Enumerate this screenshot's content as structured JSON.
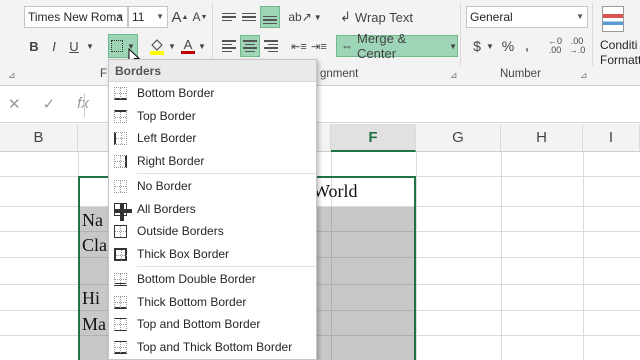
{
  "ribbon": {
    "font_name": "Times New Roma",
    "font_size": "11",
    "grow_font": "A",
    "shrink_font": "A",
    "bold": "B",
    "italic": "I",
    "underline": "U",
    "wrap_text": "Wrap Text",
    "merge_center": "Merge & Center",
    "number_format": "General",
    "currency": "$",
    "percent": "%",
    "comma": ",",
    "increase_decimal": ".00 →.0",
    "decrease_decimal": ".00 ←.0",
    "conditional_formatting_1": "Conditi",
    "conditional_formatting_2": "Formatti",
    "group_font_partial": "F",
    "group_alignment_partial": "gnment",
    "group_number": "Number"
  },
  "formula_bar": {
    "cancel": "✕",
    "enter": "✓",
    "function": "fx"
  },
  "columns": [
    "B",
    "F",
    "G",
    "H",
    "I"
  ],
  "active_column": "F",
  "cells": {
    "world": "World",
    "row2": "Na",
    "row3": "Cla",
    "row5": "Hi",
    "row6": "Ma"
  },
  "borders_menu": {
    "header": "Borders",
    "groups": [
      [
        {
          "label": "Bottom Border",
          "icon": "bottom-border-icon"
        },
        {
          "label": "Top Border",
          "icon": "top-border-icon"
        },
        {
          "label": "Left Border",
          "icon": "left-border-icon"
        },
        {
          "label": "Right Border",
          "icon": "right-border-icon"
        }
      ],
      [
        {
          "label": "No Border",
          "icon": "no-border-icon"
        },
        {
          "label": "All Borders",
          "icon": "all-borders-icon"
        },
        {
          "label": "Outside Borders",
          "icon": "outside-borders-icon"
        },
        {
          "label": "Thick Box Border",
          "icon": "thick-box-border-icon"
        }
      ],
      [
        {
          "label": "Bottom Double Border",
          "icon": "bottom-double-border-icon"
        },
        {
          "label": "Thick Bottom Border",
          "icon": "thick-bottom-border-icon"
        },
        {
          "label": "Top and Bottom Border",
          "icon": "top-and-bottom-border-icon"
        },
        {
          "label": "Top and Thick Bottom Border",
          "icon": "top-and-thick-bottom-border-icon"
        }
      ]
    ]
  },
  "colors": {
    "accent_green": "#217346",
    "highlight_yellow": "#ffff00",
    "font_red": "#c00000",
    "selected_button": "#9fd5b7"
  }
}
